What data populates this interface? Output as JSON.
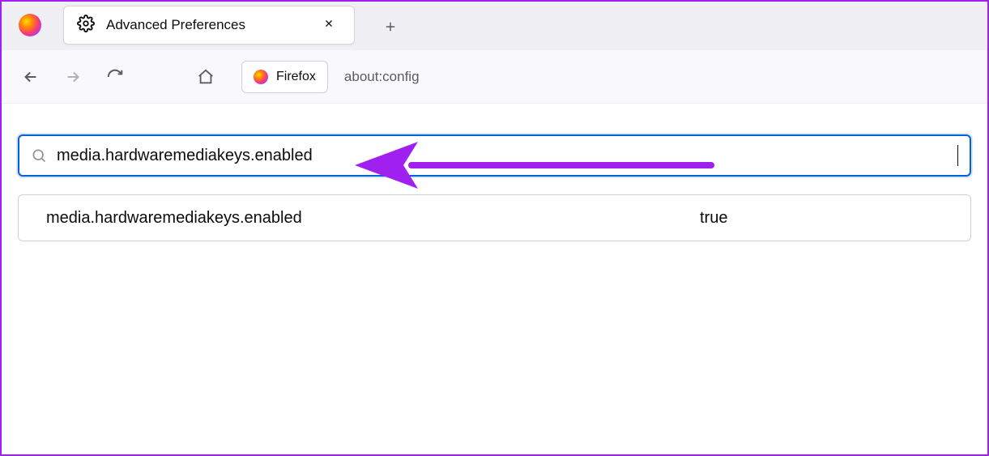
{
  "tab": {
    "title": "Advanced Preferences"
  },
  "toolbar": {
    "identity_label": "Firefox",
    "url": "about:config"
  },
  "search": {
    "value": "media.hardwaremediakeys.enabled"
  },
  "results": [
    {
      "name": "media.hardwaremediakeys.enabled",
      "value": "true"
    }
  ],
  "annotation": {
    "color": "#a020f0"
  }
}
